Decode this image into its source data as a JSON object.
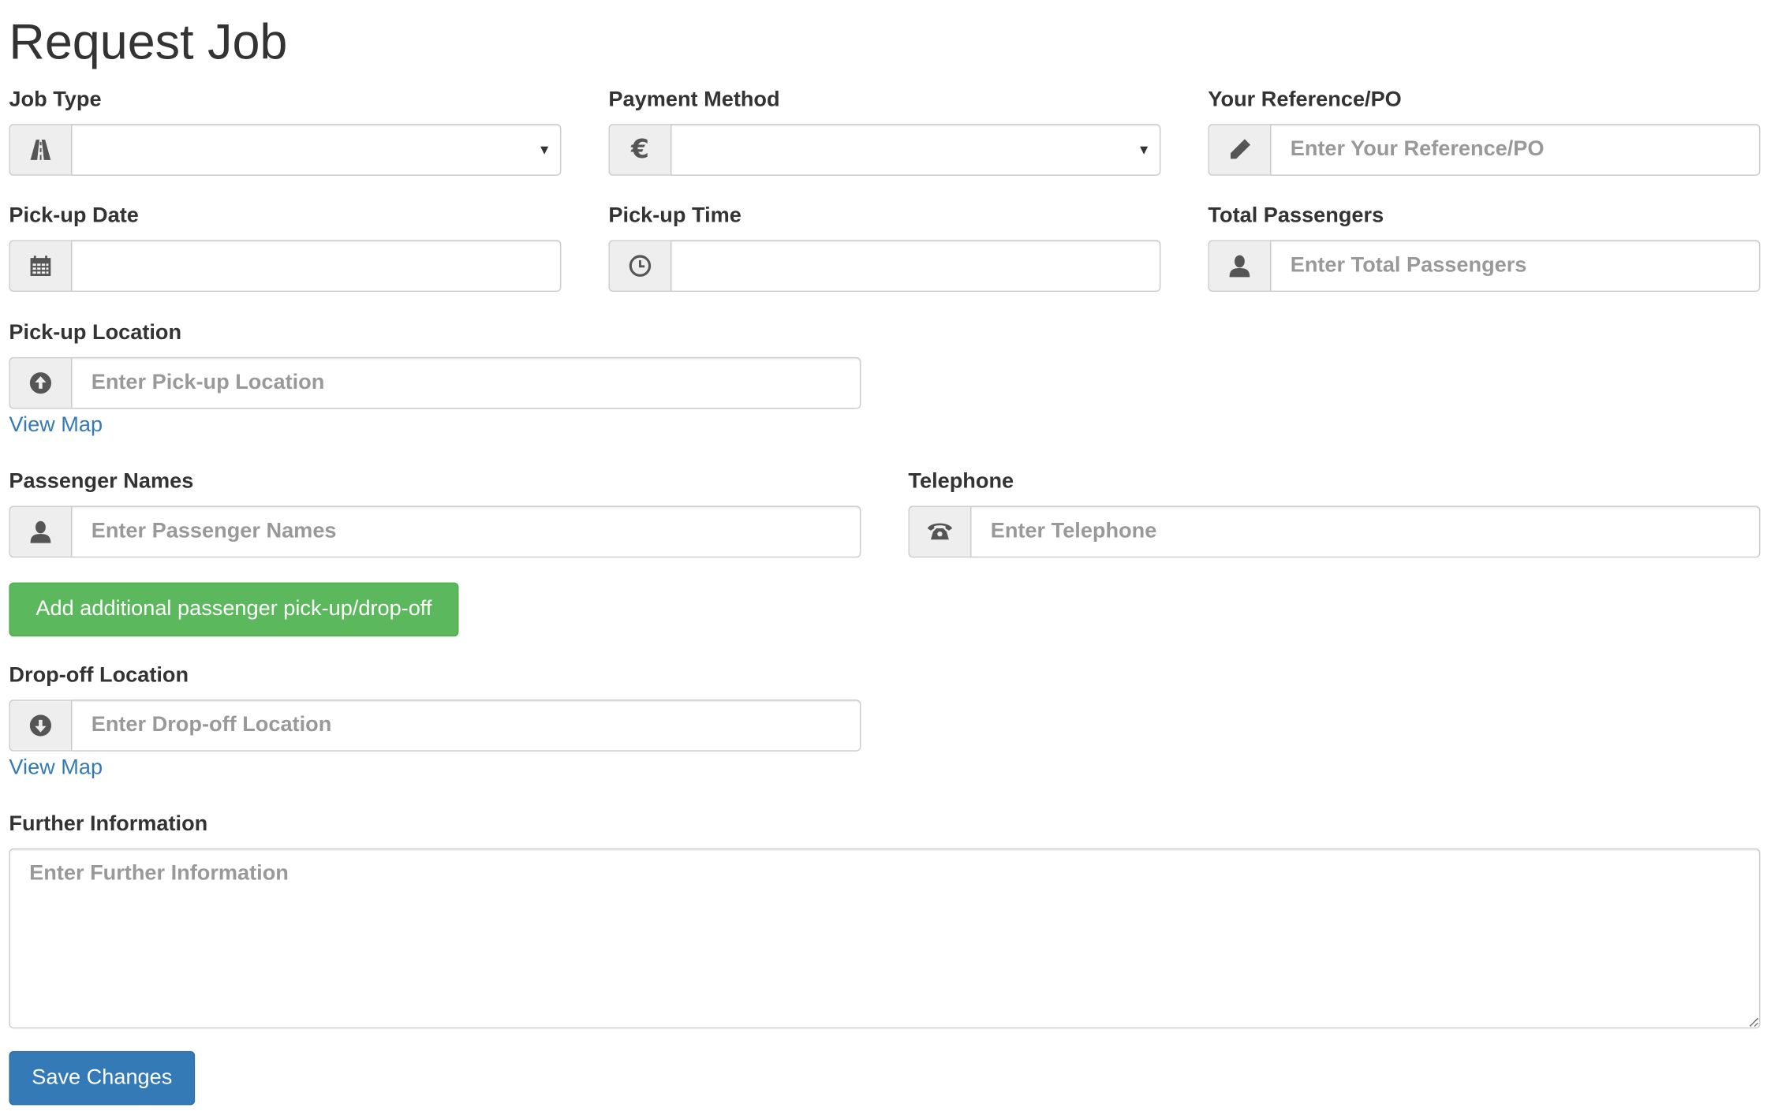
{
  "page": {
    "title": "Request Job"
  },
  "fields": {
    "job_type": {
      "label": "Job Type",
      "value": ""
    },
    "payment_method": {
      "label": "Payment Method",
      "value": ""
    },
    "reference": {
      "label": "Your Reference/PO",
      "placeholder": "Enter Your Reference/PO"
    },
    "pickup_date": {
      "label": "Pick-up Date",
      "value": ""
    },
    "pickup_time": {
      "label": "Pick-up Time",
      "value": ""
    },
    "total_passengers": {
      "label": "Total Passengers",
      "placeholder": "Enter Total Passengers"
    },
    "pickup_location": {
      "label": "Pick-up Location",
      "placeholder": "Enter Pick-up Location",
      "map_link": "View Map"
    },
    "passenger_names": {
      "label": "Passenger Names",
      "placeholder": "Enter Passenger Names"
    },
    "telephone": {
      "label": "Telephone",
      "placeholder": "Enter Telephone"
    },
    "dropoff_location": {
      "label": "Drop-off Location",
      "placeholder": "Enter Drop-off Location",
      "map_link": "View Map"
    },
    "further_information": {
      "label": "Further Information",
      "placeholder": "Enter Further Information"
    }
  },
  "buttons": {
    "add_stop": "Add additional passenger pick-up/drop-off",
    "save": "Save Changes"
  },
  "icons": {
    "job_type": "road-icon",
    "payment_method": "euro-icon",
    "reference": "pencil-icon",
    "pickup_date": "calendar-icon",
    "pickup_time": "clock-icon",
    "total_passengers": "user-icon",
    "pickup_location": "circle-arrow-up-icon",
    "passenger_names": "user-icon",
    "telephone": "phone-alt-icon",
    "dropoff_location": "circle-arrow-down-icon"
  },
  "colors": {
    "success_button": "#5cb85c",
    "primary_button": "#337ab7",
    "link": "#337ab7",
    "addon_background": "#eeeeee",
    "border": "#cccccc"
  }
}
